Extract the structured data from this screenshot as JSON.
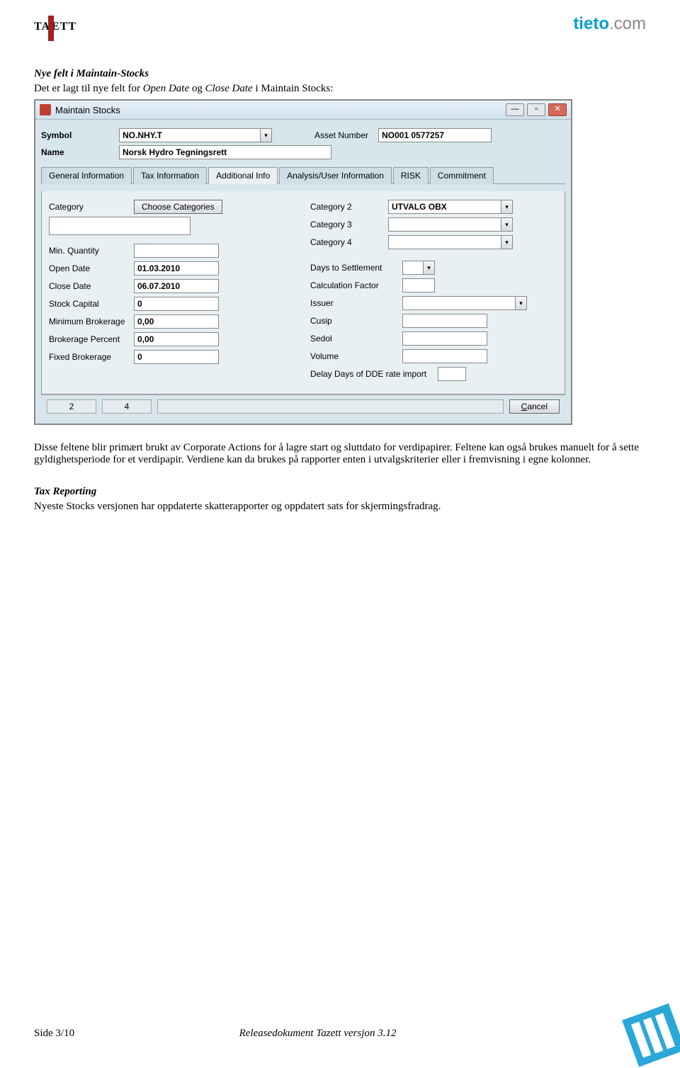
{
  "header": {
    "brand_left": "TAZETT",
    "brand_right_a": "tieto",
    "brand_right_b": ".com"
  },
  "section1": {
    "heading": "Nye felt i Maintain-Stocks",
    "intro_a": "Det er lagt til nye felt for ",
    "intro_i1": "Open Date",
    "intro_b": " og ",
    "intro_i2": "Close Date",
    "intro_c": " i Maintain Stocks:"
  },
  "window": {
    "title": "Maintain Stocks",
    "top": {
      "symbol_lbl": "Symbol",
      "symbol_val": "NO.NHY.T",
      "asset_lbl": "Asset Number",
      "asset_val": "NO001 0577257",
      "name_lbl": "Name",
      "name_val": "Norsk Hydro Tegningsrett"
    },
    "tabs": [
      "General Information",
      "Tax Information",
      "Additional Info",
      "Analysis/User Information",
      "RISK",
      "Commitment"
    ],
    "left": {
      "category_lbl": "Category",
      "category_btn": "Choose Categories",
      "minq_lbl": "Min. Quantity",
      "minq_val": "",
      "open_lbl": "Open Date",
      "open_val": "01.03.2010",
      "close_lbl": "Close Date",
      "close_val": "06.07.2010",
      "stockcap_lbl": "Stock Capital",
      "stockcap_val": "0",
      "minbrok_lbl": "Minimum Brokerage",
      "minbrok_val": "0,00",
      "brokpct_lbl": "Brokerage Percent",
      "brokpct_val": "0,00",
      "fixbrok_lbl": "Fixed Brokerage",
      "fixbrok_val": "0"
    },
    "right": {
      "cat2_lbl": "Category 2",
      "cat2_val": "UTVALG OBX",
      "cat3_lbl": "Category 3",
      "cat3_val": "",
      "cat4_lbl": "Category 4",
      "cat4_val": "",
      "days_lbl": "Days to Settlement",
      "days_val": "",
      "calc_lbl": "Calculation Factor",
      "calc_val": "",
      "issuer_lbl": "Issuer",
      "issuer_val": "",
      "cusip_lbl": "Cusip",
      "cusip_val": "",
      "sedol_lbl": "Sedol",
      "sedol_val": "",
      "vol_lbl": "Volume",
      "vol_val": "",
      "delay_lbl": "Delay Days of DDE rate import",
      "delay_val": ""
    },
    "status": {
      "a": "2",
      "b": "4",
      "cancel": "Cancel"
    }
  },
  "para1": "Disse feltene blir primært brukt av Corporate Actions for å lagre start og sluttdato for verdipapirer. Feltene kan også brukes manuelt for å sette gyldighetsperiode for et verdipapir. Verdiene kan da brukes på rapporter enten i utvalgskriterier eller i fremvisning i egne kolonner.",
  "section2": {
    "heading": "Tax Reporting",
    "text": "Nyeste Stocks versjonen har oppdaterte skatterapporter og oppdatert sats for skjermingsfradrag."
  },
  "footer": {
    "left": "Side 3/10",
    "mid": "Releasedokument Tazett versjon 3.12"
  }
}
